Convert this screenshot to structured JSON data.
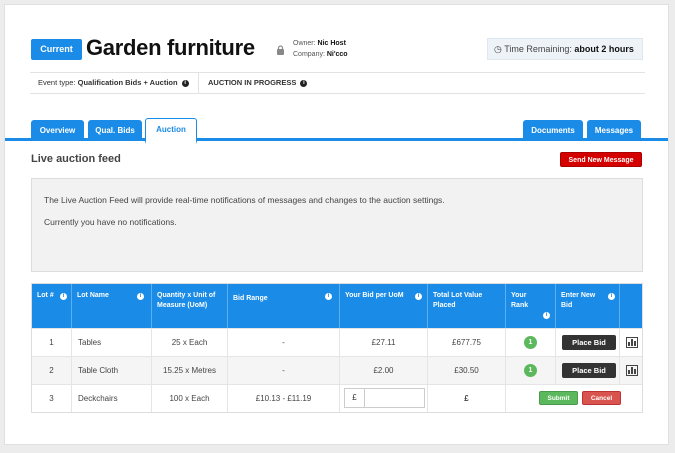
{
  "header": {
    "status_badge": "Current",
    "title": "Garden furniture",
    "owner_label": "Owner:",
    "owner_value": "Nic Host",
    "company_label": "Company:",
    "company_value": "Ni'cco",
    "time_label": "Time Remaining:",
    "time_value": "about 2 hours"
  },
  "meta": {
    "event_type_label": "Event type:",
    "event_type_value": "Qualification Bids + Auction",
    "auction_status": "AUCTION IN PROGRESS"
  },
  "tabs": {
    "left": [
      "Overview",
      "Qual. Bids",
      "Auction"
    ],
    "right": [
      "Documents",
      "Messages"
    ],
    "active": "Auction"
  },
  "feed": {
    "title": "Live auction feed",
    "send_button": "Send New Message",
    "line1": "The Live Auction Feed will provide real-time notifications of messages and changes to the auction settings.",
    "line2": "Currently you have no notifications."
  },
  "table": {
    "headers": {
      "lot": "Lot #",
      "lot_name": "Lot Name",
      "quantity": "Quantity x Unit of Measure (UoM)",
      "bid_range": "Bid Range",
      "your_bid": "Your Bid per UoM",
      "total": "Total Lot Value Placed",
      "rank": "Your Rank",
      "enter_bid": "Enter New Bid"
    },
    "rows": [
      {
        "lot": "1",
        "name": "Tables",
        "qty": "25 x Each",
        "range": "-",
        "bid": "£27.11",
        "total": "£677.75",
        "rank": "1",
        "action": "Place Bid"
      },
      {
        "lot": "2",
        "name": "Table Cloth",
        "qty": "15.25 x Metres",
        "range": "-",
        "bid": "£2.00",
        "total": "£30.50",
        "rank": "1",
        "action": "Place Bid"
      },
      {
        "lot": "3",
        "name": "Deckchairs",
        "qty": "100 x Each",
        "range": "£10.13 - £11.19",
        "currency": "£",
        "total": "£",
        "submit": "Submit",
        "cancel": "Cancel"
      }
    ]
  },
  "icons": {
    "info": "i",
    "clock": "clock-icon",
    "lock": "lock-icon",
    "chart": "bar-chart-icon"
  },
  "colors": {
    "primary": "#1a8be6",
    "danger": "#d40000",
    "success": "#5cb85c",
    "dark_button": "#333333"
  }
}
